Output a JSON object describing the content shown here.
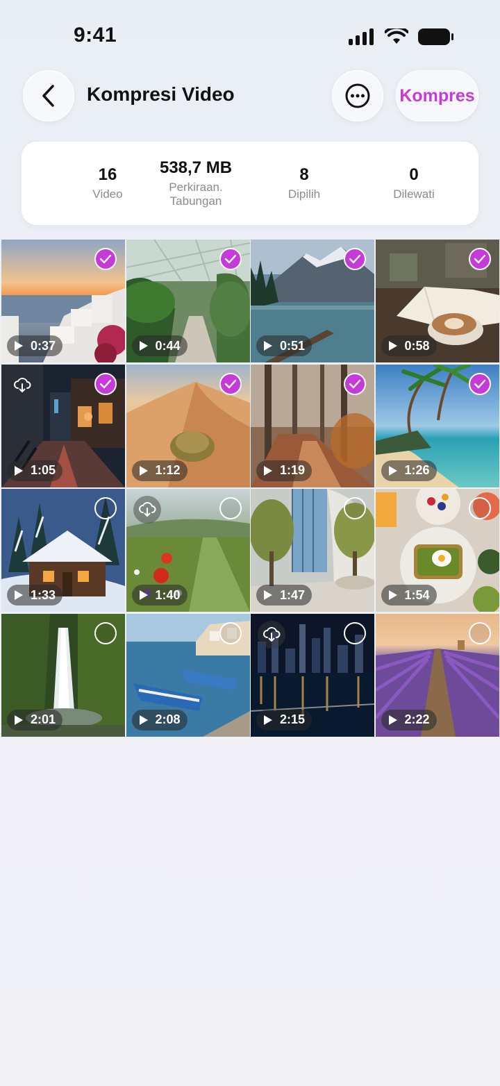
{
  "status": {
    "time": "9:41"
  },
  "header": {
    "title": "Kompresi Video",
    "action_label": "Kompres",
    "accent": "#c53ad8"
  },
  "stats": [
    {
      "value": "16",
      "label": "Video"
    },
    {
      "value": "538,7 MB",
      "label": "Perkiraan. Tabungan"
    },
    {
      "value": "8",
      "label": "Dipilih"
    },
    {
      "value": "0",
      "label": "Dilewati"
    }
  ],
  "videos": [
    {
      "scene": "santorini",
      "duration": "0:37",
      "selected": true,
      "cloud": false
    },
    {
      "scene": "greenhouse",
      "duration": "0:44",
      "selected": true,
      "cloud": false
    },
    {
      "scene": "mountain-lake",
      "duration": "0:51",
      "selected": true,
      "cloud": false
    },
    {
      "scene": "coffee-book",
      "duration": "0:58",
      "selected": true,
      "cloud": false
    },
    {
      "scene": "rainy-street",
      "duration": "1:05",
      "selected": true,
      "cloud": true
    },
    {
      "scene": "desert",
      "duration": "1:12",
      "selected": true,
      "cloud": false
    },
    {
      "scene": "autumn-forest",
      "duration": "1:19",
      "selected": true,
      "cloud": false
    },
    {
      "scene": "tropical-beach",
      "duration": "1:26",
      "selected": true,
      "cloud": false
    },
    {
      "scene": "snow-cabin",
      "duration": "1:33",
      "selected": false,
      "cloud": false
    },
    {
      "scene": "poppy-meadow",
      "duration": "1:40",
      "selected": false,
      "cloud": true
    },
    {
      "scene": "atrium-trees",
      "duration": "1:47",
      "selected": false,
      "cloud": false
    },
    {
      "scene": "brunch-table",
      "duration": "1:54",
      "selected": false,
      "cloud": false
    },
    {
      "scene": "waterfall",
      "duration": "2:01",
      "selected": false,
      "cloud": false
    },
    {
      "scene": "harbor-boats",
      "duration": "2:08",
      "selected": false,
      "cloud": false
    },
    {
      "scene": "city-night",
      "duration": "2:15",
      "selected": false,
      "cloud": true
    },
    {
      "scene": "lavender-field",
      "duration": "2:22",
      "selected": false,
      "cloud": false
    }
  ]
}
